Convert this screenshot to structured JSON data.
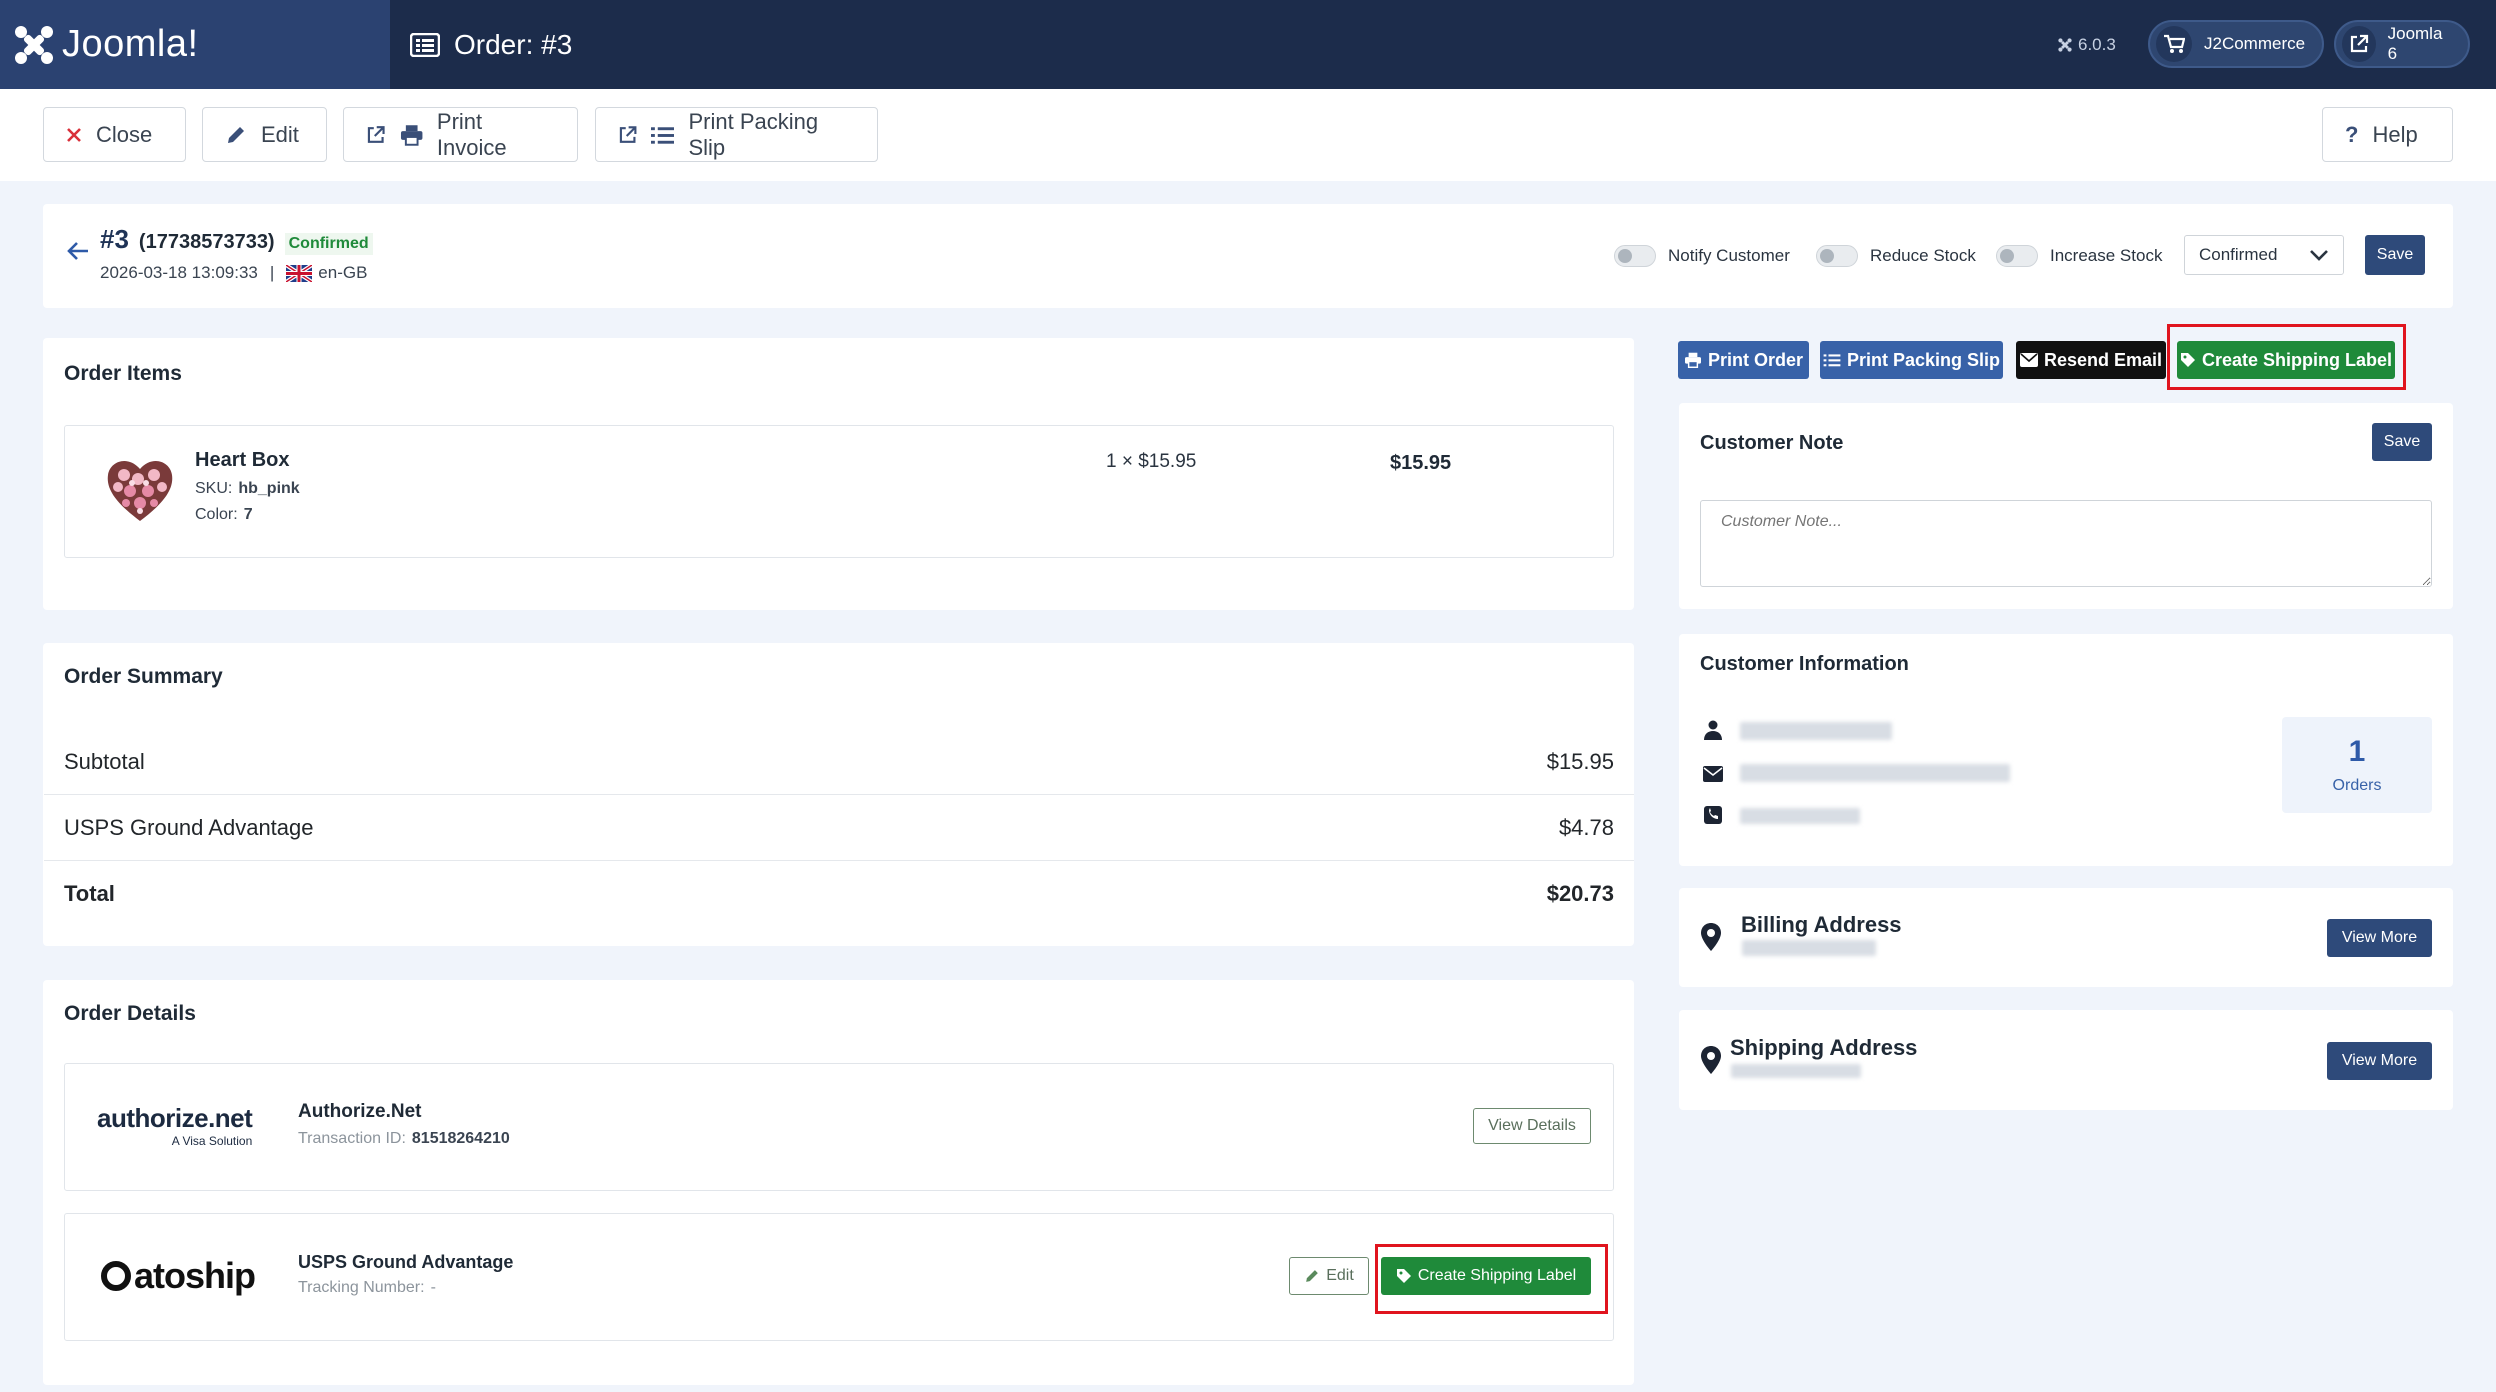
{
  "header": {
    "brand": "Joomla!",
    "page_title": "Order: #3",
    "version": "6.0.3",
    "pill_j2commerce": "J2Commerce",
    "pill_joomla": "Joomla 6"
  },
  "toolbar": {
    "close": "Close",
    "edit": "Edit",
    "print_invoice": "Print Invoice",
    "print_packing_slip": "Print Packing Slip",
    "help": "Help"
  },
  "order_head": {
    "number": "#3",
    "reference": "(17738573733)",
    "status_badge": "Confirmed",
    "datetime": "2026-03-18 13:09:33",
    "separator": "|",
    "language": "en-GB",
    "notify_customer": "Notify Customer",
    "reduce_stock": "Reduce Stock",
    "increase_stock": "Increase Stock",
    "status_select": "Confirmed",
    "save": "Save"
  },
  "actions": {
    "print_order": "Print Order",
    "print_packing_slip": "Print Packing Slip",
    "resend_email": "Resend Email",
    "create_shipping_label": "Create Shipping Label"
  },
  "order_items": {
    "title": "Order Items",
    "items": [
      {
        "name": "Heart Box",
        "sku_label": "SKU:",
        "sku": "hb_pink",
        "option_label": "Color:",
        "option_value": "7",
        "qty_price": "1 × $15.95",
        "total": "$15.95"
      }
    ]
  },
  "order_summary": {
    "title": "Order Summary",
    "rows": [
      {
        "label": "Subtotal",
        "value": "$15.95"
      },
      {
        "label": "USPS Ground Advantage",
        "value": "$4.78"
      },
      {
        "label": "Total",
        "value": "$20.73"
      }
    ]
  },
  "order_details": {
    "title": "Order Details",
    "payment": {
      "logo_main": "authorize.net",
      "logo_sub": "A Visa Solution",
      "name": "Authorize.Net",
      "txn_label": "Transaction ID:",
      "txn_id": "81518264210",
      "button": "View Details"
    },
    "shipping": {
      "logo": "atoship",
      "name": "USPS Ground Advantage",
      "tracking_label": "Tracking Number:",
      "tracking_value": "-",
      "edit": "Edit",
      "create_label": "Create Shipping Label"
    }
  },
  "customer_note": {
    "title": "Customer Note",
    "save": "Save",
    "placeholder": "Customer Note..."
  },
  "customer_info": {
    "title": "Customer Information",
    "orders_count": "1",
    "orders_label": "Orders"
  },
  "billing": {
    "title": "Billing Address",
    "button": "View More"
  },
  "shipping_address": {
    "title": "Shipping Address",
    "button": "View More"
  },
  "colors": {
    "header_bg": "#1c2c4b",
    "brand_bg": "#2b4271",
    "confirmed_green": "#1f8a3a",
    "primary_blue": "#3862a8",
    "highlight_red": "#e0141e"
  }
}
